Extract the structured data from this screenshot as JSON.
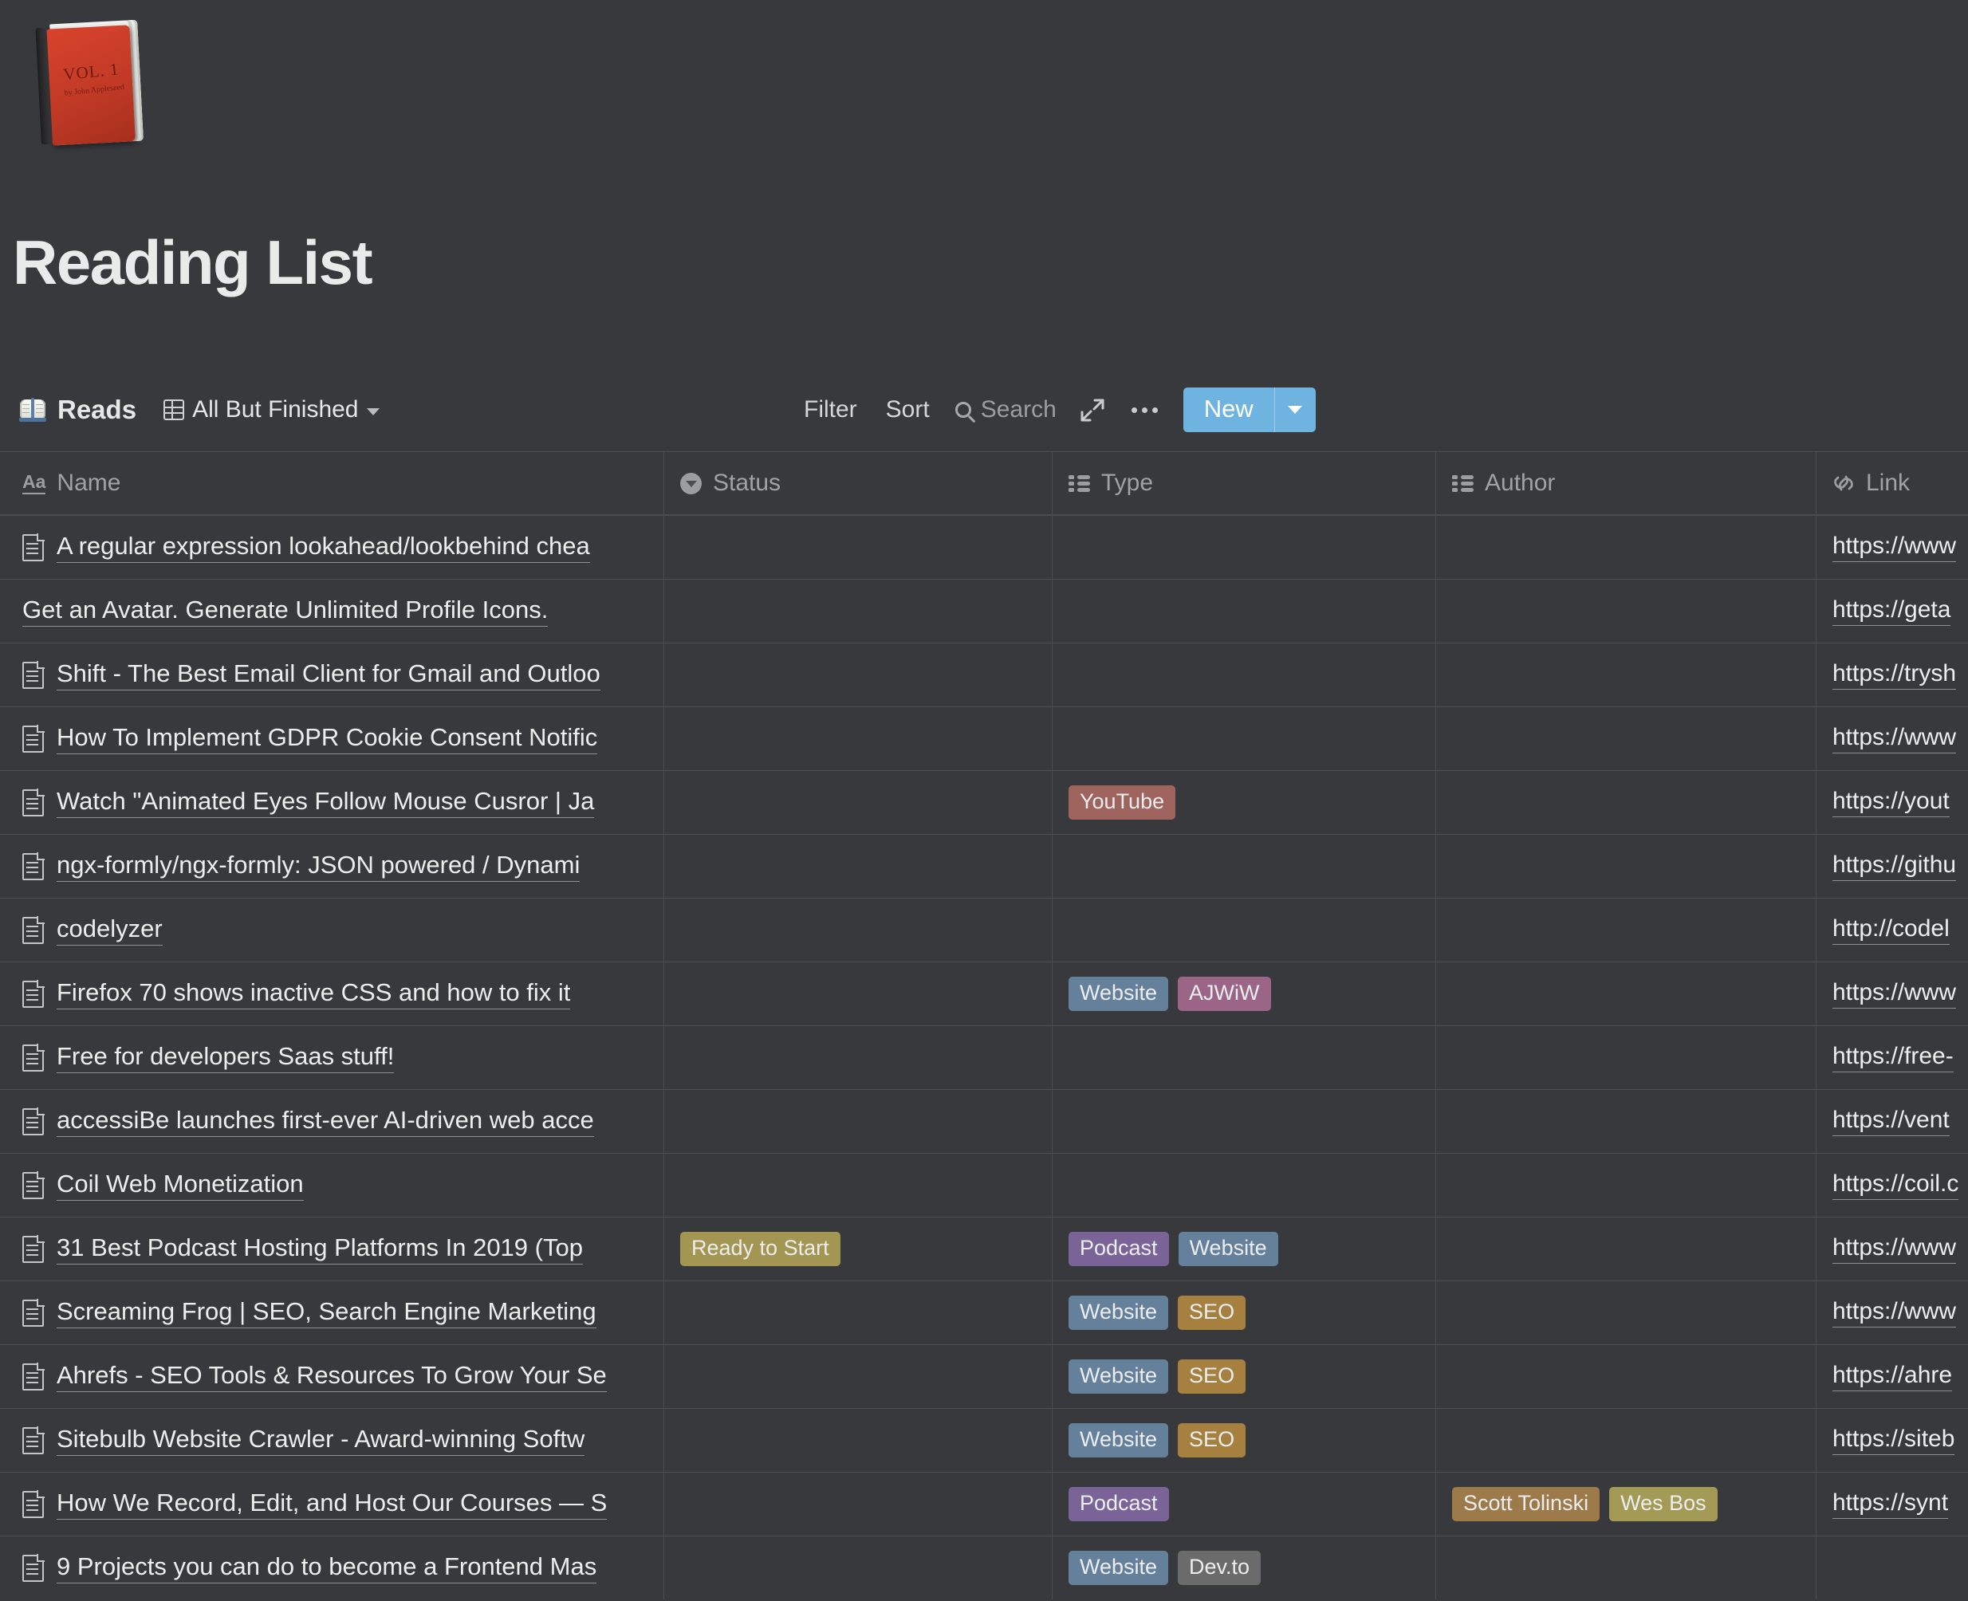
{
  "page": {
    "title": "Reading List",
    "icon": "closed-book-emoji",
    "icon_cover_line1": "VOL. 1",
    "icon_cover_line2": "by John Appleseed"
  },
  "toolbar": {
    "database_icon": "open-book-icon",
    "database_name": "Reads",
    "view_icon": "table-grid-icon",
    "view_name": "All But Finished",
    "view_chevron": "chevron-down-icon",
    "filter_label": "Filter",
    "sort_label": "Sort",
    "search_label": "Search",
    "search_icon": "search-icon",
    "expand_icon": "expand-arrows-icon",
    "more_icon": "more-horizontal-icon",
    "new_label": "New",
    "new_chevron": "chevron-down-icon",
    "new_button_color": "#6fb3e0"
  },
  "table": {
    "columns": [
      {
        "label": "Name",
        "icon": "text-aa-icon"
      },
      {
        "label": "Status",
        "icon": "select-caret-circle-icon"
      },
      {
        "label": "Type",
        "icon": "multi-select-list-icon"
      },
      {
        "label": "Author",
        "icon": "multi-select-list-icon"
      },
      {
        "label": "Link",
        "icon": "link-chain-icon"
      }
    ],
    "rows": [
      {
        "name": "A regular expression lookahead/lookbehind chea",
        "has_page_icon": true,
        "status": [],
        "type": [],
        "author": [],
        "link": "https://www"
      },
      {
        "name": "Get an Avatar. Generate Unlimited Profile Icons.",
        "has_page_icon": false,
        "status": [],
        "type": [],
        "author": [],
        "link": "https://geta"
      },
      {
        "name": "Shift - The Best Email Client for Gmail and Outloo",
        "has_page_icon": true,
        "status": [],
        "type": [],
        "author": [],
        "link": "https://trysh"
      },
      {
        "name": "How To Implement GDPR Cookie Consent Notific",
        "has_page_icon": true,
        "status": [],
        "type": [],
        "author": [],
        "link": "https://www"
      },
      {
        "name": "Watch \"Animated Eyes Follow Mouse Cusror | Ja",
        "has_page_icon": true,
        "status": [],
        "type": [
          {
            "label": "YouTube",
            "color": "#a0645f"
          }
        ],
        "author": [],
        "link": "https://yout"
      },
      {
        "name": "ngx-formly/ngx-formly: JSON powered / Dynami",
        "has_page_icon": true,
        "status": [],
        "type": [],
        "author": [],
        "link": "https://githu"
      },
      {
        "name": "codelyzer",
        "has_page_icon": true,
        "status": [],
        "type": [],
        "author": [],
        "link": "http://codel"
      },
      {
        "name": "Firefox 70 shows inactive CSS and how to fix it",
        "has_page_icon": true,
        "status": [],
        "type": [
          {
            "label": "Website",
            "color": "#64809a"
          },
          {
            "label": "AJWiW",
            "color": "#9b6587"
          }
        ],
        "author": [],
        "link": "https://www"
      },
      {
        "name": "Free for developers Saas stuff!",
        "has_page_icon": true,
        "status": [],
        "type": [],
        "author": [],
        "link": "https://free-"
      },
      {
        "name": "accessiBe launches first-ever AI-driven web acce",
        "has_page_icon": true,
        "status": [],
        "type": [],
        "author": [],
        "link": "https://vent"
      },
      {
        "name": "Coil Web Monetization",
        "has_page_icon": true,
        "status": [],
        "type": [],
        "author": [],
        "link": "https://coil.c"
      },
      {
        "name": "31 Best Podcast Hosting Platforms In 2019 (Top ",
        "has_page_icon": true,
        "status": [
          {
            "label": "Ready to Start",
            "color": "#a39652"
          }
        ],
        "type": [
          {
            "label": "Podcast",
            "color": "#7a6497"
          },
          {
            "label": "Website",
            "color": "#64809a"
          }
        ],
        "author": [],
        "link": "https://www"
      },
      {
        "name": "Screaming Frog | SEO, Search Engine Marketing",
        "has_page_icon": true,
        "status": [],
        "type": [
          {
            "label": "Website",
            "color": "#64809a"
          },
          {
            "label": "SEO",
            "color": "#a5803f"
          }
        ],
        "author": [],
        "link": "https://www"
      },
      {
        "name": "Ahrefs - SEO Tools & Resources To Grow Your Se",
        "has_page_icon": true,
        "status": [],
        "type": [
          {
            "label": "Website",
            "color": "#64809a"
          },
          {
            "label": "SEO",
            "color": "#a5803f"
          }
        ],
        "author": [],
        "link": "https://ahre"
      },
      {
        "name": "Sitebulb Website Crawler - Award-winning Softw",
        "has_page_icon": true,
        "status": [],
        "type": [
          {
            "label": "Website",
            "color": "#64809a"
          },
          {
            "label": "SEO",
            "color": "#a5803f"
          }
        ],
        "author": [],
        "link": "https://siteb"
      },
      {
        "name": "How We Record, Edit, and Host Our Courses — S",
        "has_page_icon": true,
        "status": [],
        "type": [
          {
            "label": "Podcast",
            "color": "#7a6497"
          }
        ],
        "author": [
          {
            "label": "Scott Tolinski",
            "color": "#9c7a4a"
          },
          {
            "label": "Wes Bos",
            "color": "#a39a55"
          }
        ],
        "link": "https://synt"
      },
      {
        "name": "9 Projects you can do to become a Frontend Mas",
        "has_page_icon": true,
        "status": [],
        "type": [
          {
            "label": "Website",
            "color": "#64809a"
          },
          {
            "label": "Dev.to",
            "color": "#6b6b6b"
          }
        ],
        "author": [],
        "link": ""
      }
    ]
  }
}
